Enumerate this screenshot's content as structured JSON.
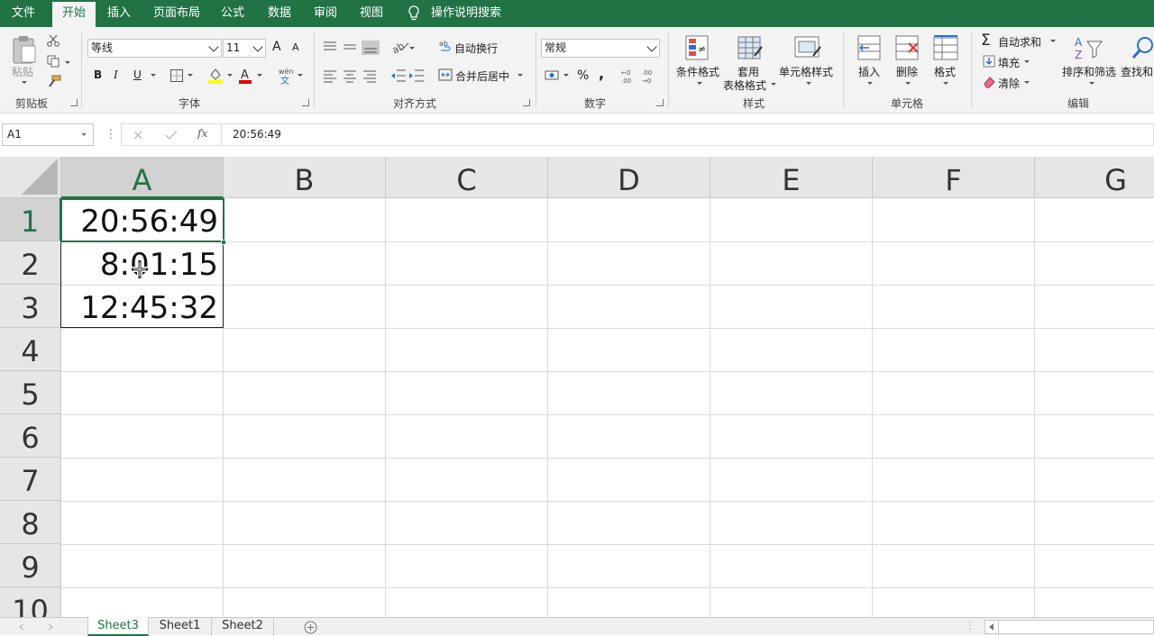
{
  "tabs": [
    {
      "label": "文件",
      "active": false
    },
    {
      "label": "开始",
      "active": true
    },
    {
      "label": "插入",
      "active": false
    },
    {
      "label": "页面布局",
      "active": false
    },
    {
      "label": "公式",
      "active": false
    },
    {
      "label": "数据",
      "active": false
    },
    {
      "label": "审阅",
      "active": false
    },
    {
      "label": "视图",
      "active": false
    }
  ],
  "search_tab": "操作说明搜索",
  "ribbon": {
    "clipboard": {
      "paste": "粘贴",
      "group": "剪贴板"
    },
    "font": {
      "name": "等线",
      "size": "11",
      "grow": "A",
      "shrink": "A",
      "bold": "B",
      "italic": "I",
      "underline": "U",
      "group": "字体"
    },
    "align": {
      "wrap": "自动换行",
      "merge": "合并后居中",
      "group": "对齐方式"
    },
    "number": {
      "format": "常规",
      "percent": "%",
      "comma": ",",
      "group": "数字"
    },
    "styles": {
      "conditional": "条件格式",
      "table_line1": "套用",
      "table_line2": "表格格式",
      "cell_styles": "单元格样式",
      "group": "样式"
    },
    "cells": {
      "insert": "插入",
      "delete": "删除",
      "format": "格式",
      "group": "单元格"
    },
    "edit": {
      "autosum": "自动求和",
      "fill": "填充",
      "clear": "清除",
      "sort": "排序和筛选",
      "find": "查找和",
      "group": "编辑"
    }
  },
  "namebox": "A1",
  "formula": "20:56:49",
  "fx_label": "fx",
  "columns": [
    "A",
    "B",
    "C",
    "D",
    "E",
    "F",
    "G"
  ],
  "rows": [
    "1",
    "2",
    "3",
    "4",
    "5",
    "6",
    "7",
    "8",
    "9",
    "10"
  ],
  "cells": [
    {
      "ref": "A1",
      "value": "20:56:49"
    },
    {
      "ref": "A2",
      "value": "8:01:15"
    },
    {
      "ref": "A3",
      "value": "12:45:32"
    }
  ],
  "sheets": [
    {
      "name": "Sheet3",
      "active": true
    },
    {
      "name": "Sheet1",
      "active": false
    },
    {
      "name": "Sheet2",
      "active": false
    }
  ],
  "colors": {
    "accent": "#217346"
  }
}
